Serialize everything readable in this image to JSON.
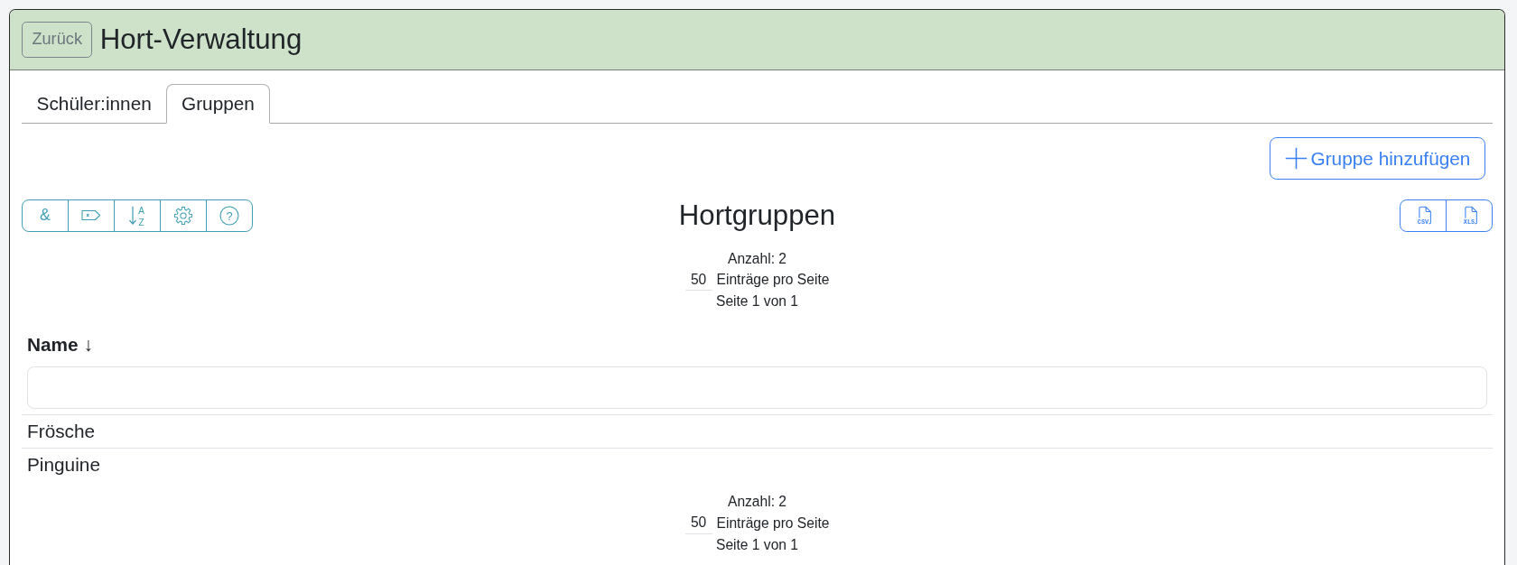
{
  "window": {
    "title": "Hort-Verwaltung",
    "back_button": "Zurück"
  },
  "tabs": [
    {
      "label": "Schüler:innen",
      "selected": false
    },
    {
      "label": "Gruppen",
      "selected": true
    }
  ],
  "add_button": {
    "label": "Gruppe hinzufügen"
  },
  "toolbar": [
    {
      "kind": "text",
      "label": "&"
    },
    {
      "kind": "tag"
    },
    {
      "kind": "sort",
      "letters": [
        "A",
        "Z"
      ]
    },
    {
      "kind": "settings"
    },
    {
      "kind": "help",
      "label": "?"
    }
  ],
  "section_title": "Hortgruppen",
  "exports": [
    {
      "label": "CSV"
    },
    {
      "label": "XLS"
    }
  ],
  "pagination_top": {
    "count": "Anzahl: 2",
    "page_size": "50",
    "page_size_label": "Einträge pro Seite",
    "page": "Seite 1 von 1"
  },
  "table": {
    "columns": [
      {
        "label": "Name ↓"
      }
    ],
    "rows": [
      {
        "name": "Frösche"
      },
      {
        "name": "Pinguine"
      }
    ]
  },
  "pagination_bottom": {
    "count": "Anzahl: 2",
    "page_size": "50",
    "page_size_label": "Einträge pro Seite",
    "page": "Seite 1 von 1"
  }
}
